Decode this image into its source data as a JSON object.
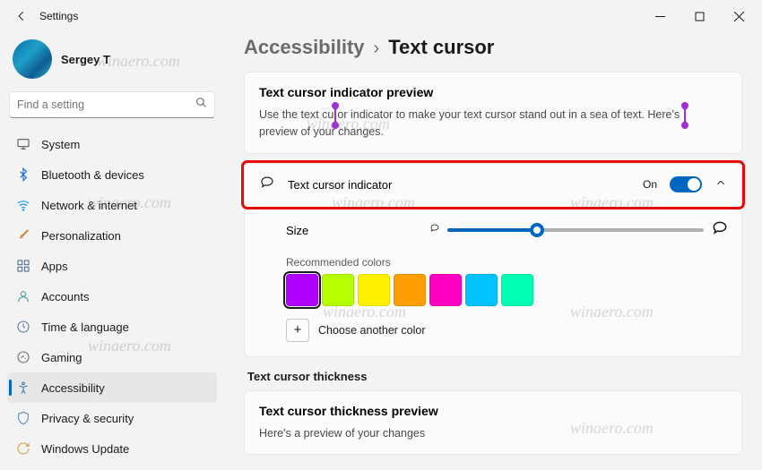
{
  "window": {
    "title": "Settings"
  },
  "user": {
    "name": "Sergey T"
  },
  "search": {
    "placeholder": "Find a setting"
  },
  "sidebar": {
    "items": [
      {
        "label": "System"
      },
      {
        "label": "Bluetooth & devices"
      },
      {
        "label": "Network & internet"
      },
      {
        "label": "Personalization"
      },
      {
        "label": "Apps"
      },
      {
        "label": "Accounts"
      },
      {
        "label": "Time & language"
      },
      {
        "label": "Gaming"
      },
      {
        "label": "Accessibility"
      },
      {
        "label": "Privacy & security"
      },
      {
        "label": "Windows Update"
      }
    ]
  },
  "breadcrumb": {
    "parent": "Accessibility",
    "separator": "›",
    "current": "Text cursor"
  },
  "preview": {
    "heading": "Text cursor indicator preview",
    "text_before": "Use the text cu",
    "text_mid": "or indicator to make your text cursor stand out in a sea of text. Here's ",
    "text_after": " preview of your changes."
  },
  "indicator": {
    "label": "Text cursor indicator",
    "state": "On"
  },
  "size": {
    "label": "Size"
  },
  "colors": {
    "heading": "Recommended colors",
    "swatches": [
      "#b200ff",
      "#b6ff00",
      "#fff200",
      "#ff9e00",
      "#ff00c3",
      "#00c3ff",
      "#00ffb2"
    ],
    "choose": "Choose another color"
  },
  "thickness": {
    "section": "Text cursor thickness",
    "heading": "Text cursor thickness preview",
    "text": "Here's a preview of your changes"
  },
  "watermark": "winaero.com"
}
